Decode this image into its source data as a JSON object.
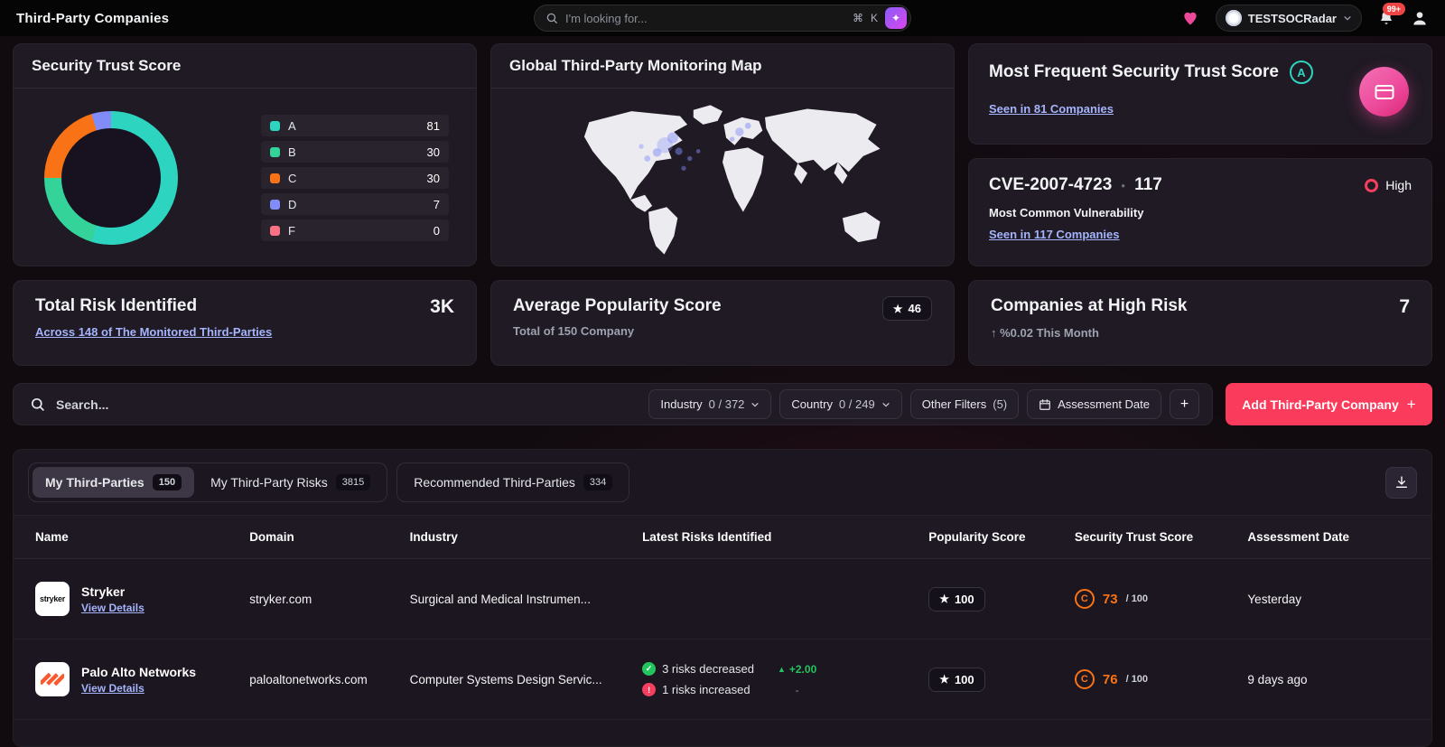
{
  "colors": {
    "accent": "#fb3b5c",
    "link": "#a5b4fc",
    "grade_c": "#f97316",
    "high": "#f43f5e",
    "teal": "#2dd4bf",
    "green": "#22c55e"
  },
  "icons": {
    "command": "⌘",
    "sparkle": "✦",
    "star": "★",
    "dot": "●",
    "up_arrow": "↑",
    "trend_up": "▲",
    "dash": "-",
    "plus": "+",
    "check": "✓",
    "exclaim": "!"
  },
  "topbar": {
    "title": "Third-Party Companies",
    "search_placeholder": "I'm looking for...",
    "shortcut_key": "K",
    "org_name": "TESTSOCRadar",
    "notification_count": "99+"
  },
  "cards": {
    "trust_score": {
      "title": "Security Trust Score",
      "legend": [
        {
          "label": "A",
          "value": 81,
          "color": "#2dd4bf"
        },
        {
          "label": "B",
          "value": 30,
          "color": "#34d399"
        },
        {
          "label": "C",
          "value": 30,
          "color": "#f97316"
        },
        {
          "label": "D",
          "value": 7,
          "color": "#818cf8"
        },
        {
          "label": "F",
          "value": 0,
          "color": "#fb7185"
        }
      ]
    },
    "map": {
      "title": "Global Third-Party Monitoring Map"
    },
    "most_frequent": {
      "title": "Most Frequent Security Trust Score",
      "grade": "A",
      "link": "Seen in 81 Companies"
    },
    "cve": {
      "title": "CVE-2007-4723",
      "count": "117",
      "severity": "High",
      "subtitle": "Most Common Vulnerability",
      "link": "Seen in 117 Companies"
    },
    "total_risk": {
      "title": "Total Risk Identified",
      "value": "3K",
      "link": "Across 148 of The Monitored Third-Parties"
    },
    "avg_popularity": {
      "title": "Average Popularity Score",
      "score": "46",
      "subtitle": "Total of 150 Company"
    },
    "high_risk": {
      "title": "Companies at High Risk",
      "value": "7",
      "trend": "%0.02 This Month"
    }
  },
  "filters": {
    "search_placeholder": "Search...",
    "industry_label": "Industry",
    "industry_count": "0 / 372",
    "country_label": "Country",
    "country_count": "0 / 249",
    "other_label": "Other Filters",
    "other_count": "(5)",
    "assessment_label": "Assessment Date",
    "add_label": "Add Third-Party Company"
  },
  "tabs": [
    {
      "label": "My Third-Parties",
      "count": "150"
    },
    {
      "label": "My Third-Party Risks",
      "count": "3815"
    },
    {
      "label": "Recommended Third-Parties",
      "count": "334"
    }
  ],
  "table": {
    "headers": [
      "Name",
      "Domain",
      "Industry",
      "Latest Risks Identified",
      "Popularity Score",
      "Security Trust Score",
      "Assessment Date"
    ],
    "rows": [
      {
        "name": "Stryker",
        "logo_text": "stryker",
        "details": "View Details",
        "domain": "stryker.com",
        "industry": "Surgical and Medical Instrumen...",
        "popularity": "100",
        "grade": "C",
        "score": "73",
        "score_max": "/ 100",
        "date": "Yesterday"
      },
      {
        "name": "Palo Alto Networks",
        "details": "View Details",
        "domain": "paloaltonetworks.com",
        "industry": "Computer Systems Design Servic...",
        "risks_decreased": "3 risks decreased",
        "risks_increased": "1 risks increased",
        "trend_value": "+2.00",
        "trend_secondary": "-",
        "popularity": "100",
        "grade": "C",
        "score": "76",
        "score_max": "/ 100",
        "date": "9 days ago"
      }
    ]
  }
}
